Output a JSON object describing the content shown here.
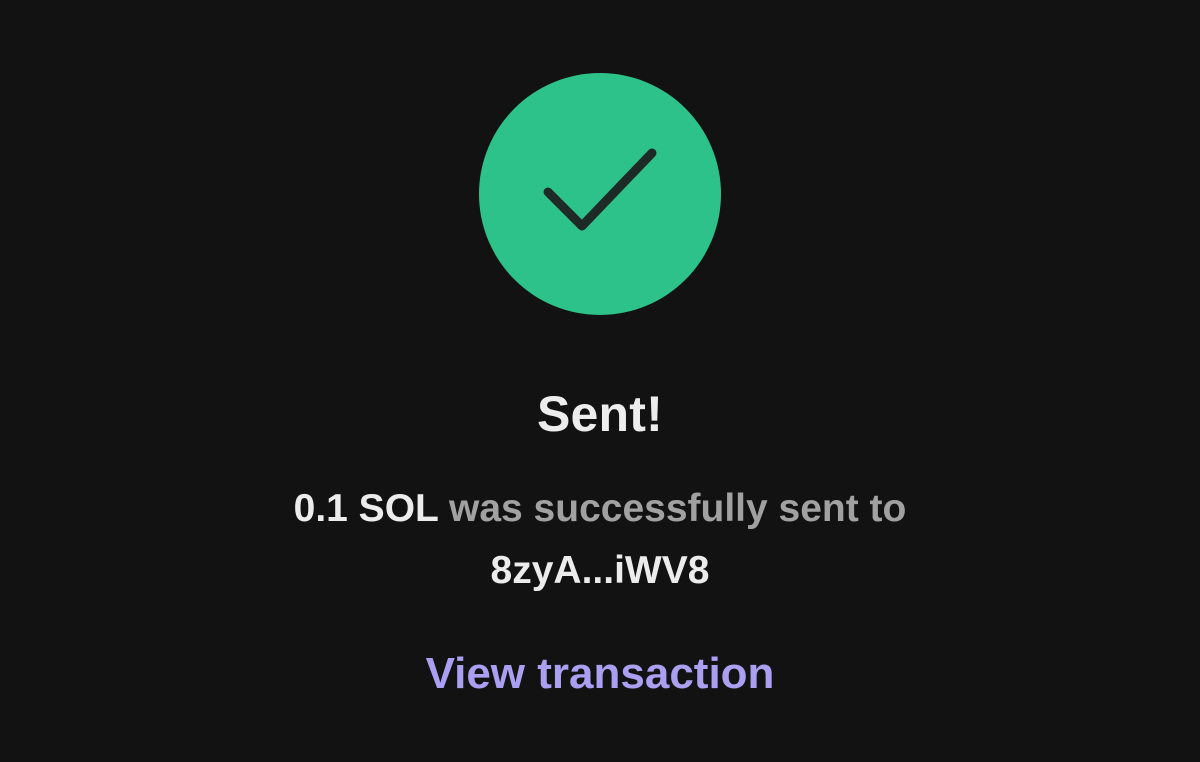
{
  "status_icon": "checkmark-icon",
  "colors": {
    "background": "#121212",
    "success": "#2ec28b",
    "check_stroke": "#1e2a25",
    "primary_text": "#ececec",
    "secondary_text": "#a1a1a1",
    "link": "#ab9ff2"
  },
  "title": "Sent!",
  "message": {
    "amount": "0.1 SOL",
    "text": "was successfully sent to",
    "recipient": "8zyA...iWV8"
  },
  "link_label": "View transaction"
}
